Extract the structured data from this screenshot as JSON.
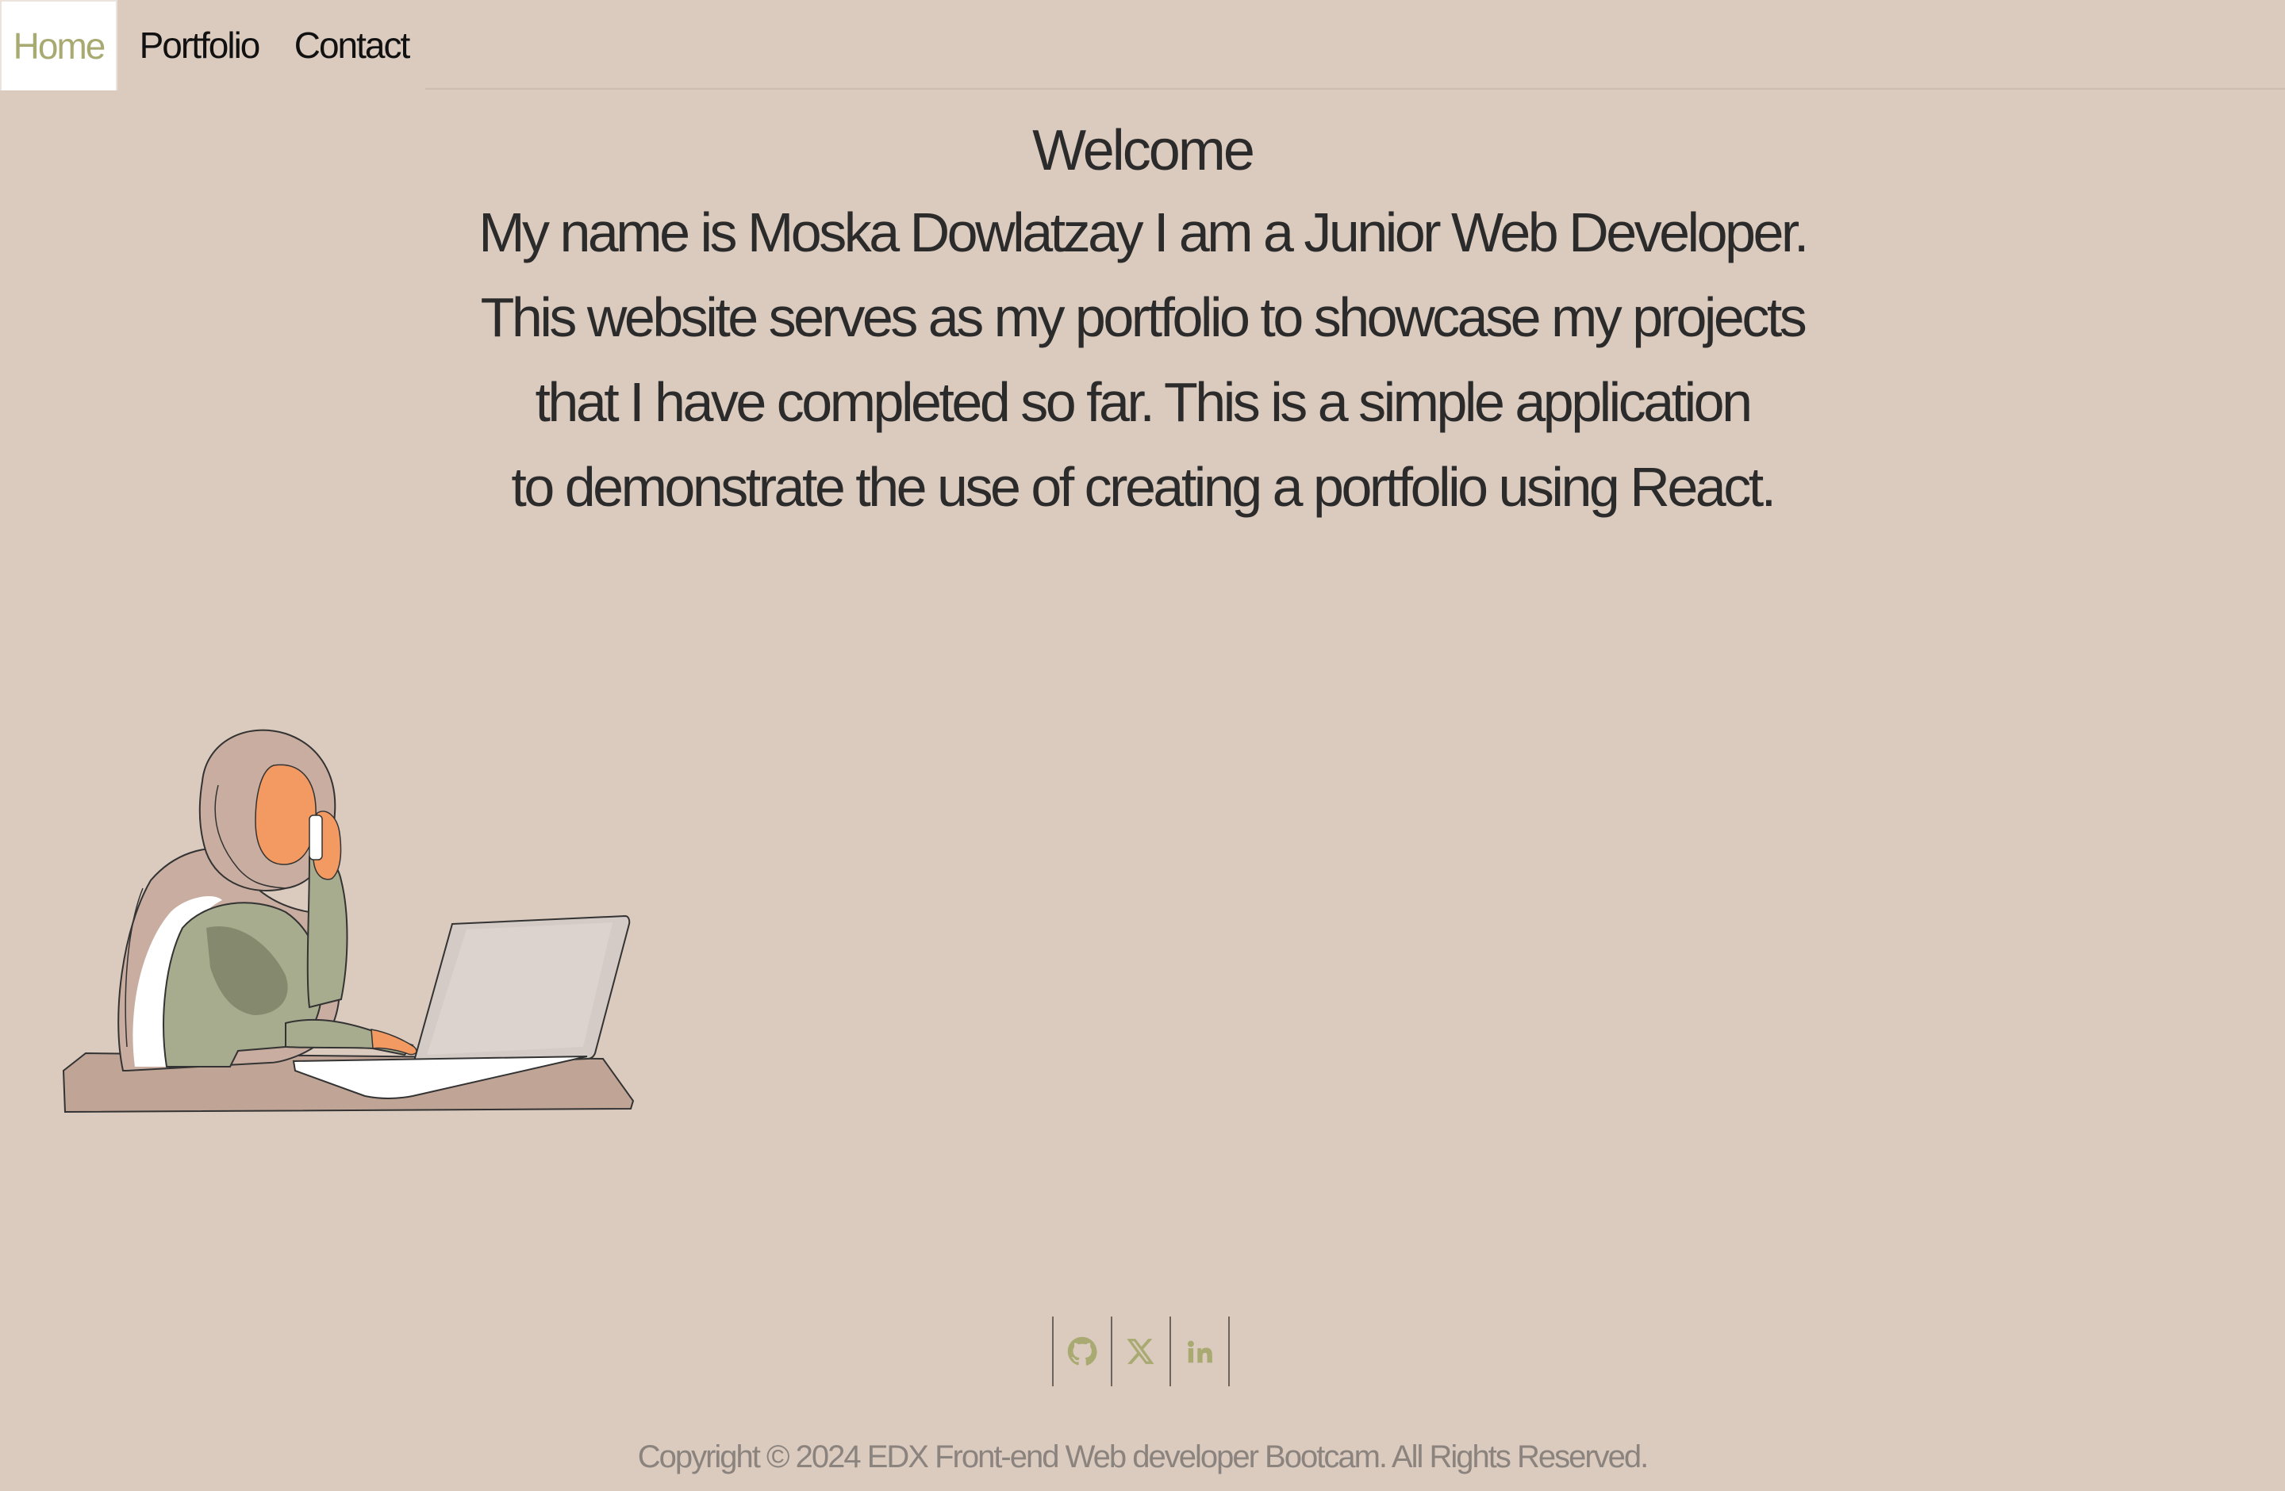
{
  "nav": {
    "tabs": [
      {
        "label": "Home",
        "active": true
      },
      {
        "label": "Portfolio",
        "active": false
      },
      {
        "label": "Contact",
        "active": false
      }
    ]
  },
  "hero": {
    "title": "Welcome",
    "lines": [
      "My name is Moska Dowlatzay I am a Junior Web Developer.",
      "This website serves as my portfolio to showcase my projects",
      "that I have completed so far. This is a simple application",
      "to demonstrate the use of creating a portfolio using React."
    ]
  },
  "socials": [
    {
      "icon": "github-icon"
    },
    {
      "icon": "x-twitter-icon"
    },
    {
      "icon": "linkedin-icon"
    }
  ],
  "footer": {
    "copyright": "Copyright © 2024 EDX Front-end Web developer Bootcam. All Rights Reserved."
  },
  "colors": {
    "background": "#dbcabe",
    "accent": "#a8aa72",
    "text": "#2b2b2b",
    "footer_text": "#8b837e"
  }
}
